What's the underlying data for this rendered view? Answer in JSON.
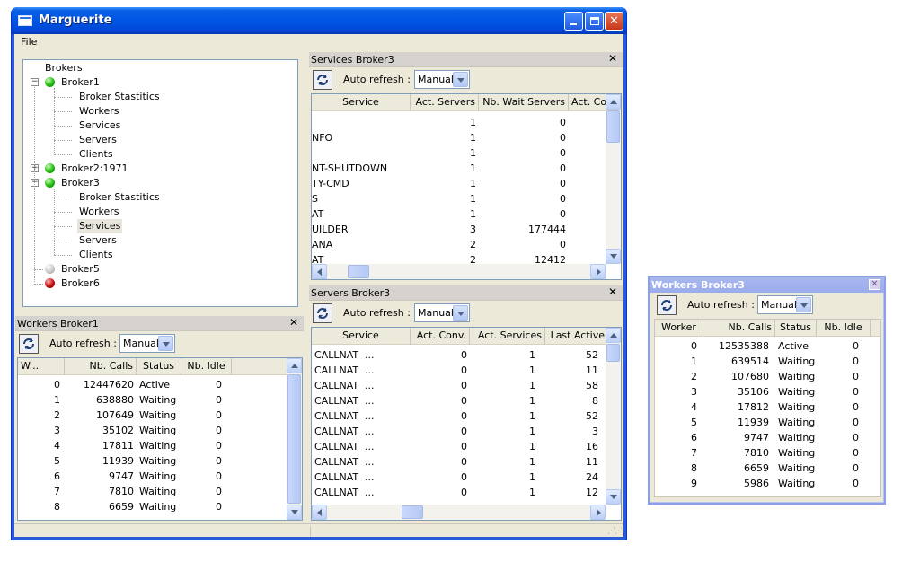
{
  "window": {
    "title": "Marguerite"
  },
  "menu": {
    "file": "File"
  },
  "tree": {
    "root": "Brokers",
    "nodes": [
      {
        "label": "Broker1",
        "status": "green",
        "children": [
          "Broker Stastitics",
          "Workers",
          "Services",
          "Servers",
          "Clients"
        ]
      },
      {
        "label": "Broker2:1971",
        "status": "green"
      },
      {
        "label": "Broker3",
        "status": "green",
        "children": [
          "Broker Stastitics",
          "Workers",
          "Services",
          "Servers",
          "Clients"
        ],
        "selected_child": "Services"
      },
      {
        "label": "Broker5",
        "status": "grey"
      },
      {
        "label": "Broker6",
        "status": "red"
      }
    ]
  },
  "auto_refresh_label": "Auto refresh :",
  "refresh_mode": "Manual",
  "services_panel": {
    "title": "Services Broker3",
    "columns": [
      "Service",
      "Act. Servers",
      "Nb. Wait Servers",
      "Act. Co"
    ],
    "rows": [
      [
        "",
        "1",
        "0"
      ],
      [
        "NFO",
        "1",
        "0"
      ],
      [
        "",
        "1",
        "0"
      ],
      [
        "NT-SHUTDOWN",
        "1",
        "0"
      ],
      [
        "TY-CMD",
        "1",
        "0"
      ],
      [
        "S",
        "1",
        "0"
      ],
      [
        "AT",
        "1",
        "0"
      ],
      [
        "UILDER",
        "3",
        "177444"
      ],
      [
        "ANA",
        "2",
        "0"
      ],
      [
        "AT",
        "2",
        "12412"
      ]
    ]
  },
  "servers_panel": {
    "title": "Servers Broker3",
    "columns": [
      "Service",
      "Act. Conv.",
      "Act. Services",
      "Last Active"
    ],
    "rows": [
      [
        "CALLNAT",
        "...",
        "0",
        "1",
        "52"
      ],
      [
        "CALLNAT",
        "...",
        "0",
        "1",
        "11"
      ],
      [
        "CALLNAT",
        "...",
        "0",
        "1",
        "58"
      ],
      [
        "CALLNAT",
        "...",
        "0",
        "1",
        "8"
      ],
      [
        "CALLNAT",
        "...",
        "0",
        "1",
        "52"
      ],
      [
        "CALLNAT",
        "...",
        "0",
        "1",
        "3"
      ],
      [
        "CALLNAT",
        "...",
        "0",
        "1",
        "16"
      ],
      [
        "CALLNAT",
        "...",
        "0",
        "1",
        "11"
      ],
      [
        "CALLNAT",
        "...",
        "0",
        "1",
        "24"
      ],
      [
        "CALLNAT",
        "...",
        "0",
        "1",
        "12"
      ]
    ]
  },
  "workers1_panel": {
    "title": "Workers Broker1",
    "columns": [
      "W...",
      "Nb. Calls",
      "Status",
      "Nb. Idle"
    ],
    "rows": [
      [
        "0",
        "12447620",
        "Active",
        "0"
      ],
      [
        "1",
        "638880",
        "Waiting",
        "0"
      ],
      [
        "2",
        "107649",
        "Waiting",
        "0"
      ],
      [
        "3",
        "35102",
        "Waiting",
        "0"
      ],
      [
        "4",
        "17811",
        "Waiting",
        "0"
      ],
      [
        "5",
        "11939",
        "Waiting",
        "0"
      ],
      [
        "6",
        "9747",
        "Waiting",
        "0"
      ],
      [
        "7",
        "7810",
        "Waiting",
        "0"
      ],
      [
        "8",
        "6659",
        "Waiting",
        "0"
      ]
    ]
  },
  "workers3_window": {
    "title": "Workers Broker3",
    "columns": [
      "Worker",
      "Nb. Calls",
      "Status",
      "Nb. Idle"
    ],
    "rows": [
      [
        "0",
        "12535388",
        "Active",
        "0"
      ],
      [
        "1",
        "639514",
        "Waiting",
        "0"
      ],
      [
        "2",
        "107680",
        "Waiting",
        "0"
      ],
      [
        "3",
        "35106",
        "Waiting",
        "0"
      ],
      [
        "4",
        "17812",
        "Waiting",
        "0"
      ],
      [
        "5",
        "11939",
        "Waiting",
        "0"
      ],
      [
        "6",
        "9747",
        "Waiting",
        "0"
      ],
      [
        "7",
        "7810",
        "Waiting",
        "0"
      ],
      [
        "8",
        "6659",
        "Waiting",
        "0"
      ],
      [
        "9",
        "5986",
        "Waiting",
        "0"
      ]
    ]
  }
}
